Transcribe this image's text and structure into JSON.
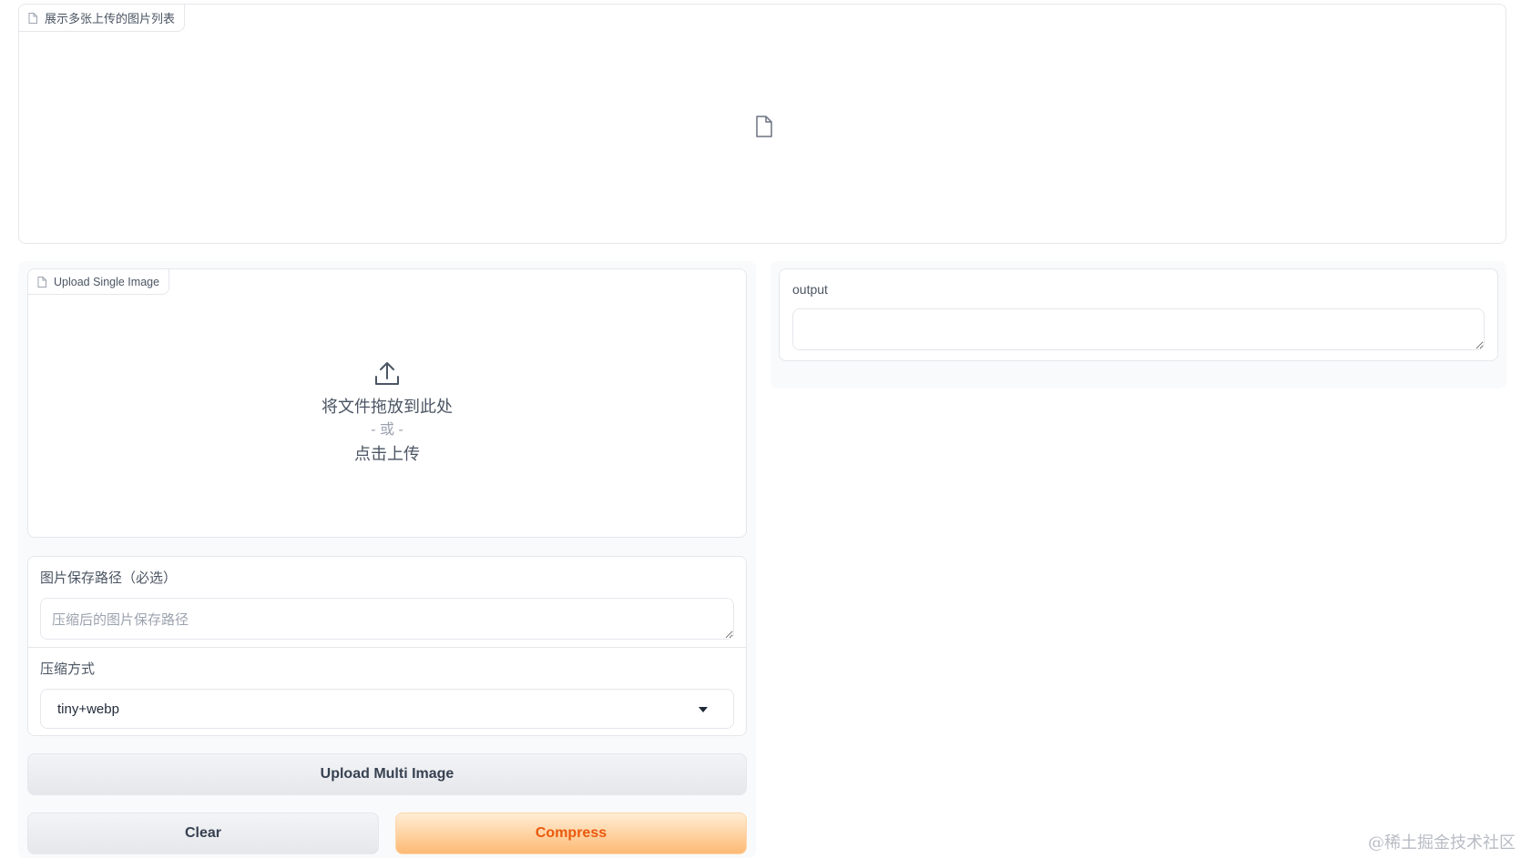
{
  "gallery": {
    "label": "展示多张上传的图片列表",
    "empty_icon": "file-icon"
  },
  "upload": {
    "label": "Upload Single Image",
    "drop_text": "将文件拖放到此处",
    "or_text": "- 或 -",
    "click_text": "点击上传",
    "icon": "upload-icon"
  },
  "save_path": {
    "label": "图片保存路径（必选）",
    "placeholder": "压缩后的图片保存路径",
    "value": ""
  },
  "compress_method": {
    "label": "压缩方式",
    "selected": "tiny+webp"
  },
  "buttons": {
    "upload_multi": "Upload Multi Image",
    "clear": "Clear",
    "compress": "Compress"
  },
  "output": {
    "label": "output",
    "value": ""
  },
  "watermark": "@稀土掘金技术社区",
  "colors": {
    "accent_text": "#ea580c",
    "accent_bg_top": "#ffedd5",
    "accent_bg_bottom": "#fdba74",
    "border": "#e5e7eb"
  }
}
